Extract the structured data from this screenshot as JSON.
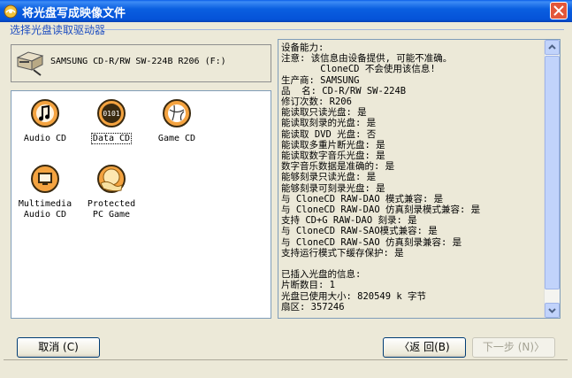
{
  "window": {
    "title": "将光盘写成映像文件"
  },
  "section": {
    "label": "选择光盘读取驱动器"
  },
  "drive": {
    "name": "SAMSUNG CD-R/RW SW-224B R206  (F:)"
  },
  "cd_types": [
    {
      "label": "Audio CD",
      "icon": "music-note-icon"
    },
    {
      "label": "Data CD",
      "icon": "binary-data-icon",
      "selected": true
    },
    {
      "label": "Game CD",
      "icon": "volleyball-icon"
    },
    {
      "label": "Multimedia\nAudio CD",
      "icon": "monitor-icon"
    },
    {
      "label": "Protected\nPC Game",
      "icon": "hand-disc-icon"
    }
  ],
  "info_lines": [
    "设备能力:",
    "注意: 该信息由设备提供, 可能不准确。",
    "       CloneCD 不会使用该信息!",
    "生产商: SAMSUNG",
    "品  名: CD-R/RW SW-224B",
    "修订次数: R206",
    "能读取只读光盘: 是",
    "能读取刻录的光盘: 是",
    "能读取 DVD 光盘: 否",
    "能读取多重片断光盘: 是",
    "能读取数字音乐光盘: 是",
    "数字音乐数据是准确的: 是",
    "能够刻录只读光盘: 是",
    "能够刻录可刻录光盘: 是",
    "与 CloneCD RAW-DAO 模式兼容: 是",
    "与 CloneCD RAW-DAO 仿真刻录模式兼容: 是",
    "支持 CD+G RAW-DAO 刻录: 是",
    "与 CloneCD RAW-SAO模式兼容: 是",
    "与 CloneCD RAW-SAO 仿真刻录兼容: 是",
    "支持运行模式下缓存保护: 是",
    "",
    "已插入光盘的信息:",
    "片断数目: 1",
    "光盘已使用大小: 820549 k 字节",
    "扇区: 357246"
  ],
  "buttons": {
    "cancel": "取消 (C)",
    "back": "〈返 回(B)",
    "next": "下一步 (N)〉"
  },
  "colors": {
    "titlebar": "#0a5fe0",
    "accent": "#1f4ec0"
  }
}
